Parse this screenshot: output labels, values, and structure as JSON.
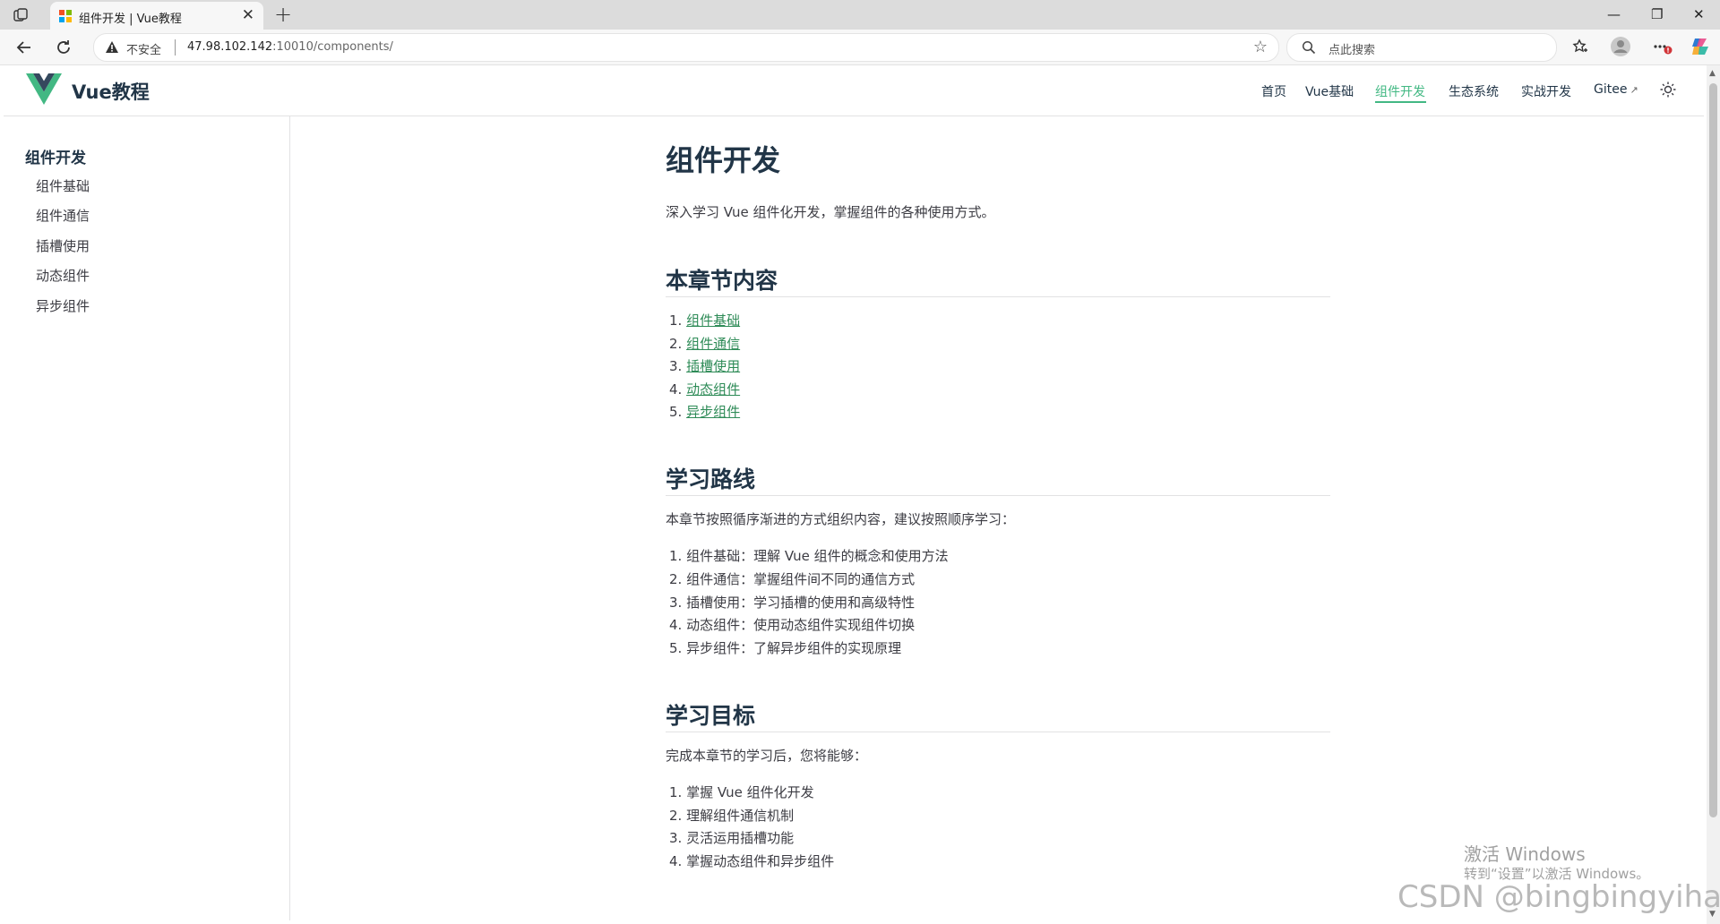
{
  "browser": {
    "tab_title": "组件开发 | Vue教程",
    "tab_close": "✕",
    "new_tab": "+",
    "security_label": "不安全",
    "url_host": "47.98.102.142",
    "url_rest": ":10010/components/",
    "search_placeholder": "点此搜索",
    "window_controls": {
      "minimize": "—",
      "restore": "❐",
      "close": "✕"
    }
  },
  "site": {
    "brand": "Vue教程",
    "brand_color": "#42b883",
    "nav": [
      {
        "label": "首页",
        "active": false
      },
      {
        "label": "Vue基础",
        "active": false
      },
      {
        "label": "组件开发",
        "active": true
      },
      {
        "label": "生态系统",
        "active": false
      },
      {
        "label": "实战开发",
        "active": false
      },
      {
        "label": "Gitee",
        "active": false,
        "external": true
      }
    ],
    "external_icon": "↗"
  },
  "sidebar": {
    "title": "组件开发",
    "items": [
      "组件基础",
      "组件通信",
      "插槽使用",
      "动态组件",
      "异步组件"
    ]
  },
  "content": {
    "title": "组件开发",
    "intro": "深入学习 Vue 组件化开发，掌握组件的各种使用方式。",
    "sections": [
      {
        "heading": "本章节内容",
        "links": [
          "组件基础",
          "组件通信",
          "插槽使用",
          "动态组件",
          "异步组件"
        ]
      },
      {
        "heading": "学习路线",
        "intro": "本章节按照循序渐进的方式组织内容，建议按照顺序学习：",
        "items": [
          "组件基础：理解 Vue 组件的概念和使用方法",
          "组件通信：掌握组件间不同的通信方式",
          "插槽使用：学习插槽的使用和高级特性",
          "动态组件：使用动态组件实现组件切换",
          "异步组件：了解异步组件的实现原理"
        ]
      },
      {
        "heading": "学习目标",
        "intro": "完成本章节的学习后，您将能够：",
        "items": [
          "掌握 Vue 组件化开发",
          "理解组件通信机制",
          "灵活运用插槽功能",
          "掌握动态组件和异步组件"
        ]
      }
    ]
  },
  "overlay": {
    "activation_title": "激活 Windows",
    "activation_sub": "转到“设置”以激活 Windows。",
    "csdn_watermark": "CSDN @bingbingyihao"
  }
}
